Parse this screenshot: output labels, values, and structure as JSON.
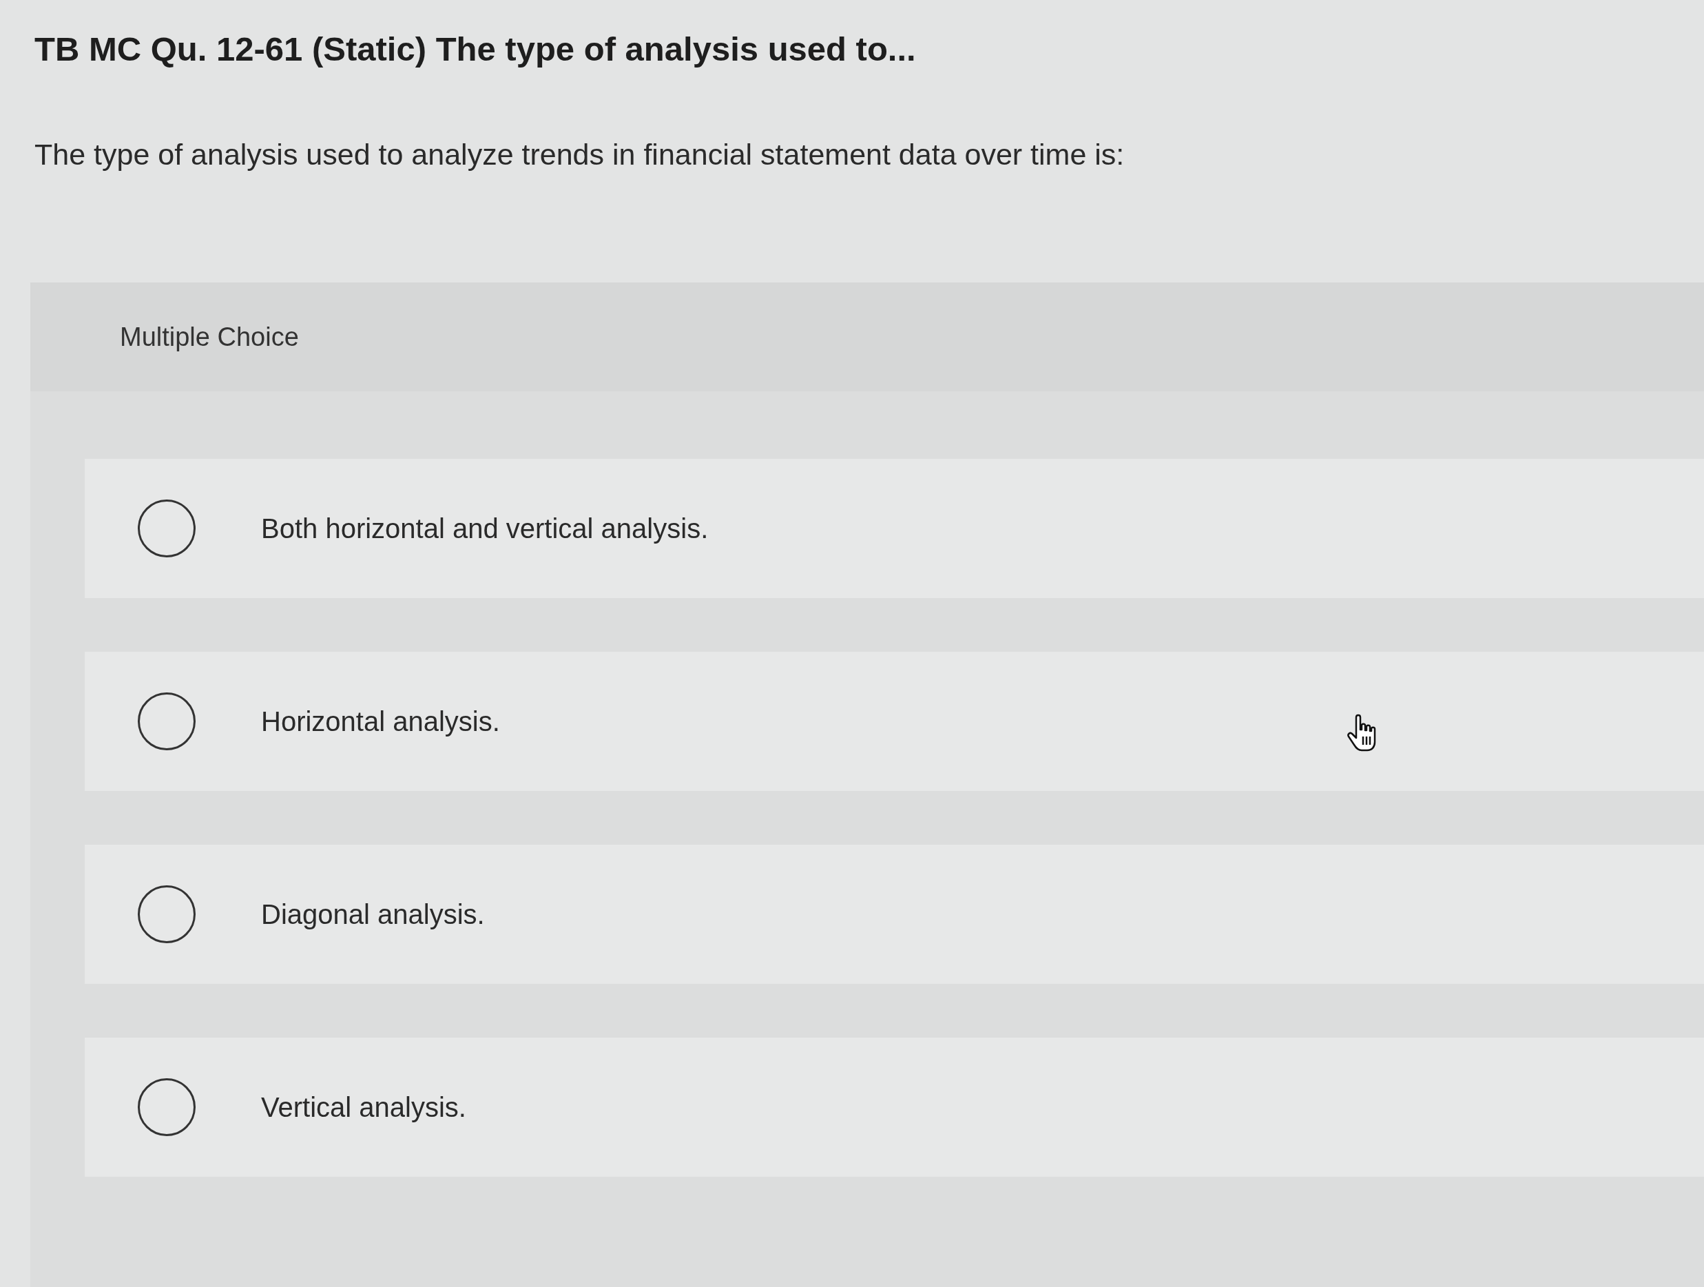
{
  "question": {
    "title": "TB MC Qu. 12-61 (Static) The type of analysis used to...",
    "prompt": "The type of analysis used to analyze trends in financial statement data over time is:"
  },
  "answer_panel": {
    "heading": "Multiple Choice",
    "options": [
      {
        "label": "Both horizontal and vertical analysis.",
        "selected": false
      },
      {
        "label": "Horizontal analysis.",
        "selected": false
      },
      {
        "label": "Diagonal analysis.",
        "selected": false
      },
      {
        "label": "Vertical analysis.",
        "selected": false
      }
    ]
  }
}
